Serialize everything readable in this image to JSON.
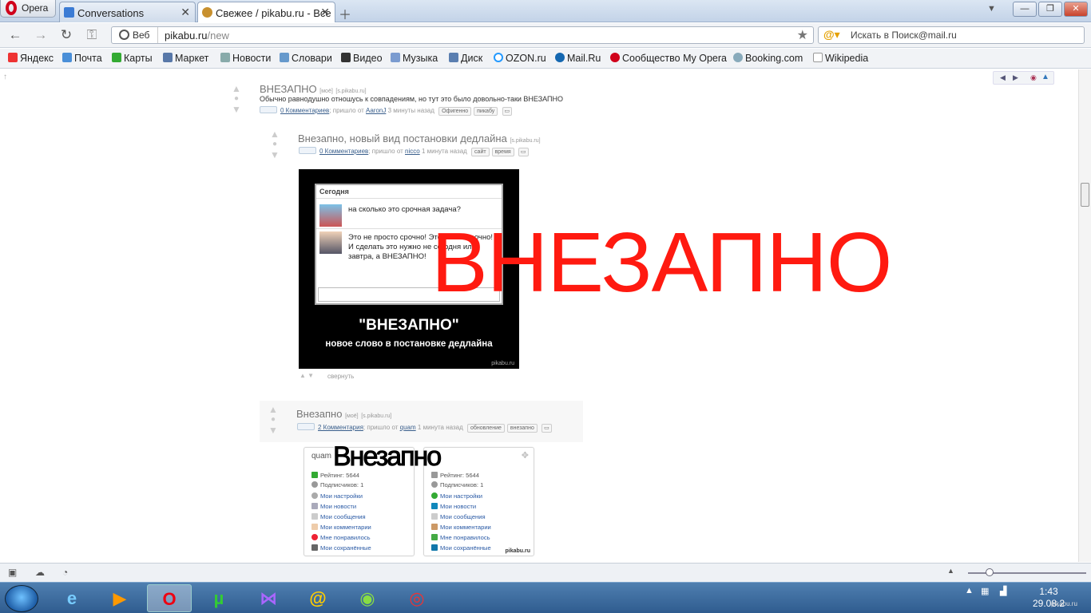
{
  "browser": {
    "menu_label": "Opera",
    "tabs": [
      {
        "title": "Conversations"
      },
      {
        "title": "Свежее / pikabu.ru - Все"
      }
    ],
    "nav": {
      "back": "←",
      "forward": "→",
      "reload": "↻",
      "key": "⚿"
    },
    "address": {
      "scope": "Веб",
      "host": "pikabu.ru",
      "path": "/new"
    },
    "search_placeholder": "Искать в Поиск@mail.ru",
    "bookmarks": [
      "Яндекс",
      "Почта",
      "Карты",
      "Маркет",
      "Новости",
      "Словари",
      "Видео",
      "Музыка",
      "Диск",
      "OZON.ru",
      "Mail.Ru",
      "Сообщество My Opera",
      "Booking.com",
      "Wikipedia"
    ]
  },
  "posts": [
    {
      "title": "ВНЕЗАПНО",
      "new_mark": "[моё]",
      "source": "[s.pikabu.ru]",
      "description": "Обычно равнодушно отношусь к совпадениям, но тут это было довольно-таки ВНЕЗАПНО",
      "comments": "0 Комментариев",
      "from_label": "; пришло от",
      "author": "AaronJ",
      "time": "3 минуты назад",
      "tags": [
        "Офигенно",
        "пикабу"
      ]
    },
    {
      "title": "Внезапно, новый вид постановки дедлайна",
      "source": "[s.pikabu.ru]",
      "comments": "0 Комментариев",
      "from_label": "; пришло от",
      "author": "nicco",
      "time": "1 минута назад",
      "tags": [
        "сайт",
        "время"
      ],
      "collapse": "свернуть",
      "image": {
        "chat_header": "Сегодня",
        "msg1": "на сколько это срочная задача?",
        "msg2": "Это не просто срочно! Это очень срочно!\nИ сделать это нужно не сегодня или завтра, а ВНЕЗАПНО!",
        "caption_big": "\"ВНЕЗАПНО\"",
        "caption_small": "новое слово в постановке дедлайна",
        "watermark": "pikabu.ru"
      }
    },
    {
      "title": "Внезапно",
      "new_mark": "[моё]",
      "source": "[s.pikabu.ru]",
      "comments": "2 Комментария",
      "from_label": "; пришло от",
      "author": "quam",
      "time": "1 минута назад",
      "tags": [
        "обновление",
        "внезапно"
      ],
      "image": {
        "overlay": "Внезапно",
        "watermark": "pikabu.ru",
        "left_card": {
          "name": "quam",
          "rating": "Рейтинг: 5644",
          "subs": "Подписчиков: 1",
          "links": [
            "Мои настройки",
            "Мои новости",
            "Мои сообщения",
            "Мои комментарии",
            "Мне понравилось",
            "Мои сохранённые"
          ]
        },
        "right_card": {
          "rating": "Рейтинг: 5644",
          "subs": "Подписчиков: 1",
          "links": [
            "Мои настройки",
            "Мои новости",
            "Мои сообщения",
            "Мои комментарии",
            "Мне понравилось",
            "Мои сохранённые"
          ]
        }
      }
    }
  ],
  "overlay_text": "ВНЕЗАПНО",
  "taskbar": {
    "time": "1:43",
    "date": "29.08.2",
    "site_mark": "pikabu.ru"
  },
  "colors": {
    "overlay_red": "#ff1a10",
    "link": "#3a5f8c",
    "taskbar": "#3a6a9e"
  }
}
